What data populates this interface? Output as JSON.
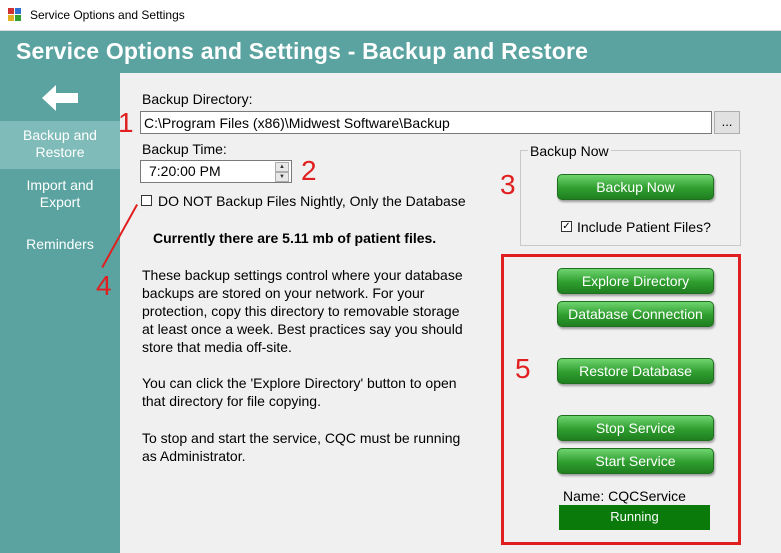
{
  "window": {
    "title": "Service Options and Settings"
  },
  "header": {
    "title": "Service Options and Settings - Backup and Restore"
  },
  "sidebar": {
    "items": [
      {
        "label": "Backup and\nRestore",
        "active": true
      },
      {
        "label": "Import and\nExport",
        "active": false
      },
      {
        "label": "Reminders",
        "active": false
      }
    ]
  },
  "backup": {
    "directory_label": "Backup Directory:",
    "directory_value": "C:\\Program Files (x86)\\Midwest Software\\Backup",
    "browse_label": "...",
    "time_label": "Backup Time:",
    "time_value": "7:20:00 PM",
    "nightly_checkbox_label": "DO NOT Backup Files Nightly, Only the Database",
    "files_summary": "Currently there are 5.11 mb of patient files.",
    "paragraph1": "These backup settings control where your database\nbackups are stored on your network.  For your\nprotection, copy this directory to removable storage\nat least once a week.  Best practices say you should\nstore that media off-site.",
    "paragraph2": "You can click the 'Explore Directory' button to open\nthat directory for file copying.",
    "paragraph3": "To stop and start the service, CQC must be running\nas Administrator."
  },
  "backup_now": {
    "group_label": "Backup Now",
    "button_label": "Backup Now",
    "include_label": "Include Patient Files?",
    "include_checked": true
  },
  "actions": {
    "explore": "Explore Directory",
    "db_connection": "Database Connection",
    "restore": "Restore Database",
    "stop": "Stop Service",
    "start": "Start Service"
  },
  "service": {
    "name_label": "Name: CQCService",
    "status": "Running"
  },
  "annotations": [
    "1",
    "2",
    "3",
    "4",
    "5"
  ],
  "colors": {
    "accent": "#5aa3a0",
    "button_green": "#2f9e2f",
    "annotation_red": "#e02020",
    "status_green": "#0a7a0a"
  }
}
